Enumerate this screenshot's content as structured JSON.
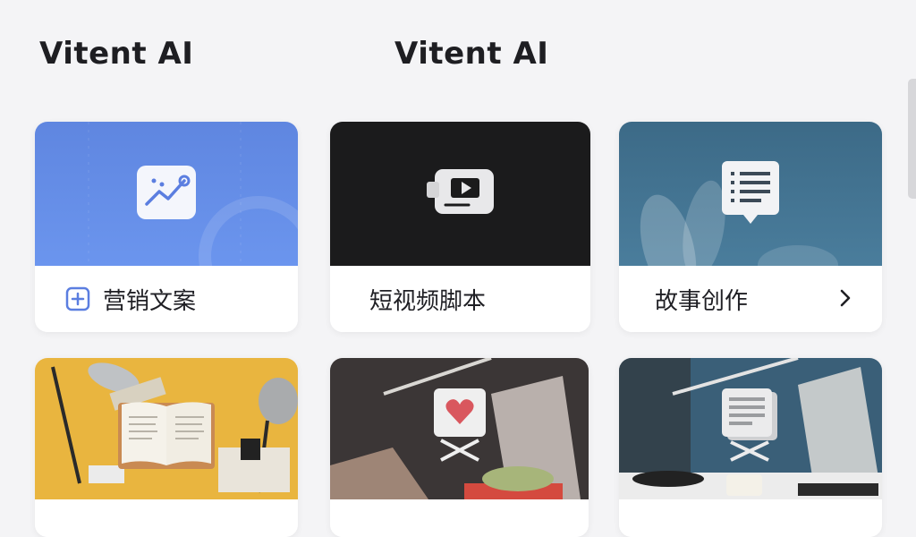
{
  "header": {
    "brand_left": "Vitent AI",
    "brand_right": "Vitent AI"
  },
  "cards": [
    {
      "label": "营销文案",
      "icon": "chart-trend-icon",
      "action_icon": "plus-square-icon"
    },
    {
      "label": "短视频脚本",
      "icon": "video-camera-icon"
    },
    {
      "label": "故事创作",
      "icon": "list-document-icon",
      "action_icon": "chevron-right-icon"
    },
    {
      "label": "",
      "icon": "open-book-icon"
    },
    {
      "label": "",
      "icon": "heart-icon"
    },
    {
      "label": "",
      "icon": "document-lines-icon"
    }
  ],
  "colors": {
    "accent": "#5b7ee0",
    "text": "#1f1f24",
    "background": "#f4f4f6"
  }
}
